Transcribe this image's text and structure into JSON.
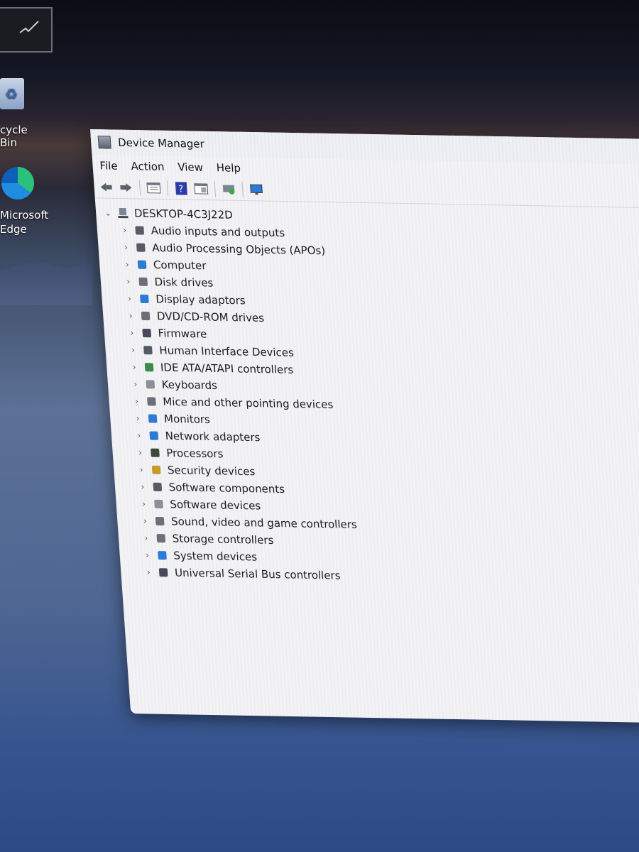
{
  "desktop": {
    "icons": [
      {
        "label": "cycle Bin",
        "icon": "recycle-bin-icon"
      },
      {
        "label": "Microsoft Edge",
        "icon": "edge-icon"
      }
    ]
  },
  "window": {
    "title": "Device Manager",
    "menu": [
      "File",
      "Action",
      "View",
      "Help"
    ],
    "toolbar": [
      "back-arrow-icon",
      "forward-arrow-icon",
      "properties-icon",
      "help-icon",
      "show-hide-icon",
      "scan-hardware-icon",
      "monitor-icon"
    ],
    "tree": {
      "root": "DESKTOP-4C3J22D",
      "items": [
        {
          "label": "Audio inputs and outputs",
          "icon": "speaker-icon",
          "color": "#555a63"
        },
        {
          "label": "Audio Processing Objects (APOs)",
          "icon": "speaker-icon",
          "color": "#555a63"
        },
        {
          "label": "Computer",
          "icon": "computer-icon",
          "color": "#2b7bd6"
        },
        {
          "label": "Disk drives",
          "icon": "disk-icon",
          "color": "#6b6f78"
        },
        {
          "label": "Display adaptors",
          "icon": "display-adapter-icon",
          "color": "#2b7bd6"
        },
        {
          "label": "DVD/CD-ROM drives",
          "icon": "dvd-icon",
          "color": "#6b6f78"
        },
        {
          "label": "Firmware",
          "icon": "firmware-icon",
          "color": "#444a55"
        },
        {
          "label": "Human Interface Devices",
          "icon": "hid-icon",
          "color": "#555a63"
        },
        {
          "label": "IDE ATA/ATAPI controllers",
          "icon": "ide-icon",
          "color": "#3c8a4a"
        },
        {
          "label": "Keyboards",
          "icon": "keyboard-icon",
          "color": "#8a8f98"
        },
        {
          "label": "Mice and other pointing devices",
          "icon": "mouse-icon",
          "color": "#6b6f78"
        },
        {
          "label": "Monitors",
          "icon": "monitor-icon",
          "color": "#2b7bd6"
        },
        {
          "label": "Network adapters",
          "icon": "network-icon",
          "color": "#2b7bd6"
        },
        {
          "label": "Processors",
          "icon": "processor-icon",
          "color": "#3a4a3a"
        },
        {
          "label": "Security devices",
          "icon": "security-icon",
          "color": "#c79a2a"
        },
        {
          "label": "Software components",
          "icon": "software-component-icon",
          "color": "#555a63"
        },
        {
          "label": "Software devices",
          "icon": "software-device-icon",
          "color": "#8a8f98"
        },
        {
          "label": "Sound, video and game controllers",
          "icon": "sound-icon",
          "color": "#6b6f78"
        },
        {
          "label": "Storage controllers",
          "icon": "storage-icon",
          "color": "#6b6f78"
        },
        {
          "label": "System devices",
          "icon": "system-folder-icon",
          "color": "#2b7bd6"
        },
        {
          "label": "Universal Serial Bus controllers",
          "icon": "usb-icon",
          "color": "#444a55"
        }
      ]
    }
  }
}
